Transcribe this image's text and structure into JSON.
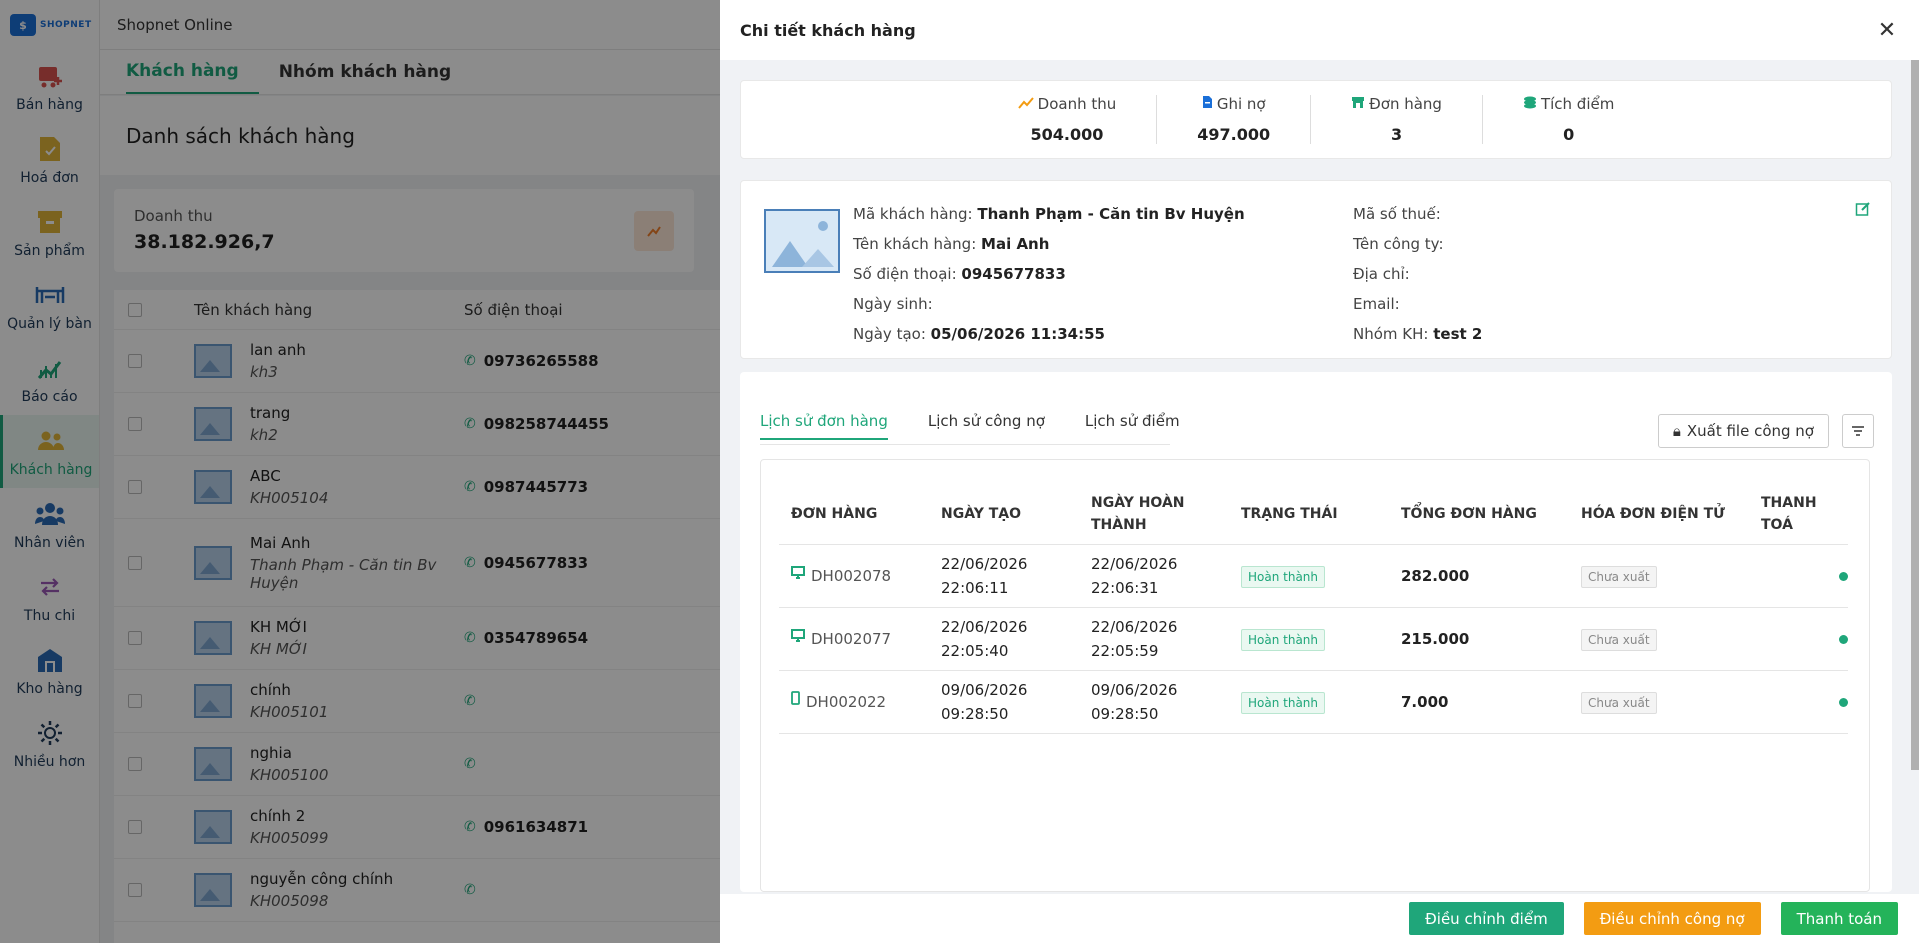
{
  "app": {
    "logo_text": "SHOPNET",
    "logo_mark": "$",
    "title": "Shopnet Online"
  },
  "sidebar": {
    "items": [
      {
        "label": "Bán hàng",
        "icon": "cart-icon",
        "color": "#d9534f"
      },
      {
        "label": "Hoá đơn",
        "icon": "invoice-icon",
        "color": "#e0b43a"
      },
      {
        "label": "Sản phẩm",
        "icon": "box-icon",
        "color": "#e0b43a"
      },
      {
        "label": "Quản lý bàn",
        "icon": "table-icon",
        "color": "#2a6bb5"
      },
      {
        "label": "Báo cáo",
        "icon": "chart-icon",
        "color": "#1fa67a"
      },
      {
        "label": "Khách hàng",
        "icon": "users-icon",
        "color": "#e0b43a"
      },
      {
        "label": "Nhân viên",
        "icon": "staff-icon",
        "color": "#2a6bb5"
      },
      {
        "label": "Thu chi",
        "icon": "exchange-icon",
        "color": "#9b59b6"
      },
      {
        "label": "Kho hàng",
        "icon": "warehouse-icon",
        "color": "#2a6bb5"
      },
      {
        "label": "Nhiều hơn",
        "icon": "gear-icon",
        "color": "#1f3b59"
      }
    ]
  },
  "main": {
    "tabs": [
      "Khách hàng",
      "Nhóm khách hàng"
    ],
    "page_title": "Danh sách khách hàng",
    "stat": {
      "label": "Doanh thu",
      "value": "38.182.926,7"
    },
    "table": {
      "headers": [
        "Tên khách hàng",
        "Số điện thoại"
      ],
      "rows": [
        {
          "name": "lan anh",
          "code": "kh3",
          "phone": "09736265588"
        },
        {
          "name": "trang",
          "code": "kh2",
          "phone": "098258744455"
        },
        {
          "name": "ABC",
          "code": "KH005104",
          "phone": "0987445773"
        },
        {
          "name": "Mai Anh",
          "code": "Thanh Phạm - Căn tin Bv Huyện",
          "phone": "0945677833"
        },
        {
          "name": "KH MỚI",
          "code": "KH MỚI",
          "phone": "0354789654"
        },
        {
          "name": "chính",
          "code": "KH005101",
          "phone": ""
        },
        {
          "name": "nghia",
          "code": "KH005100",
          "phone": ""
        },
        {
          "name": "chính 2",
          "code": "KH005099",
          "phone": "0961634871"
        },
        {
          "name": "nguyễn công chính",
          "code": "KH005098",
          "phone": ""
        }
      ]
    }
  },
  "drawer": {
    "title": "Chi tiết khách hàng",
    "summary": [
      {
        "label": "Doanh thu",
        "value": "504.000",
        "icon": "trend-up-icon"
      },
      {
        "label": "Ghi nợ",
        "value": "497.000",
        "icon": "document-icon"
      },
      {
        "label": "Đơn hàng",
        "value": "3",
        "icon": "store-icon"
      },
      {
        "label": "Tích điểm",
        "value": "0",
        "icon": "coins-icon"
      }
    ],
    "info_left": [
      {
        "label": "Mã khách hàng:",
        "value": "Thanh Phạm - Căn tin Bv Huyện"
      },
      {
        "label": "Tên khách hàng:",
        "value": "Mai Anh"
      },
      {
        "label": "Số điện thoại:",
        "value": "0945677833"
      },
      {
        "label": "Ngày sinh:",
        "value": ""
      },
      {
        "label": "Ngày tạo:",
        "value": "05/06/2026 11:34:55"
      }
    ],
    "info_right": [
      {
        "label": "Mã số thuế:",
        "value": ""
      },
      {
        "label": "Tên công ty:",
        "value": ""
      },
      {
        "label": "Địa chỉ:",
        "value": ""
      },
      {
        "label": "Email:",
        "value": ""
      },
      {
        "label": "Nhóm KH:",
        "value": "test 2"
      }
    ],
    "history_tabs": [
      "Lịch sử đơn hàng",
      "Lịch sử công nợ",
      "Lịch sử điểm"
    ],
    "export_label": "Xuất file công nợ",
    "orders": {
      "headers": [
        "ĐƠN HÀNG",
        "NGÀY TẠO",
        "NGÀY HOÀN THÀNH",
        "TRẠNG THÁI",
        "TỔNG ĐƠN HÀNG",
        "HÓA ĐƠN ĐIỆN TỬ",
        "THANH TOÁ"
      ],
      "rows": [
        {
          "id": "DH002078",
          "created": "22/06/2026 22:06:11",
          "done": "22/06/2026 22:06:31",
          "status": "Hoàn thành",
          "total": "282.000",
          "einvoice": "Chưa xuất",
          "device": "desktop-icon"
        },
        {
          "id": "DH002077",
          "created": "22/06/2026 22:05:40",
          "done": "22/06/2026 22:05:59",
          "status": "Hoàn thành",
          "total": "215.000",
          "einvoice": "Chưa xuất",
          "device": "desktop-icon"
        },
        {
          "id": "DH002022",
          "created": "09/06/2026 09:28:50",
          "done": "09/06/2026 09:28:50",
          "status": "Hoàn thành",
          "total": "7.000",
          "einvoice": "Chưa xuất",
          "device": "mobile-icon"
        }
      ]
    },
    "footer": [
      "Điều chỉnh điểm",
      "Điều chỉnh công nợ",
      "Thanh toán"
    ]
  }
}
